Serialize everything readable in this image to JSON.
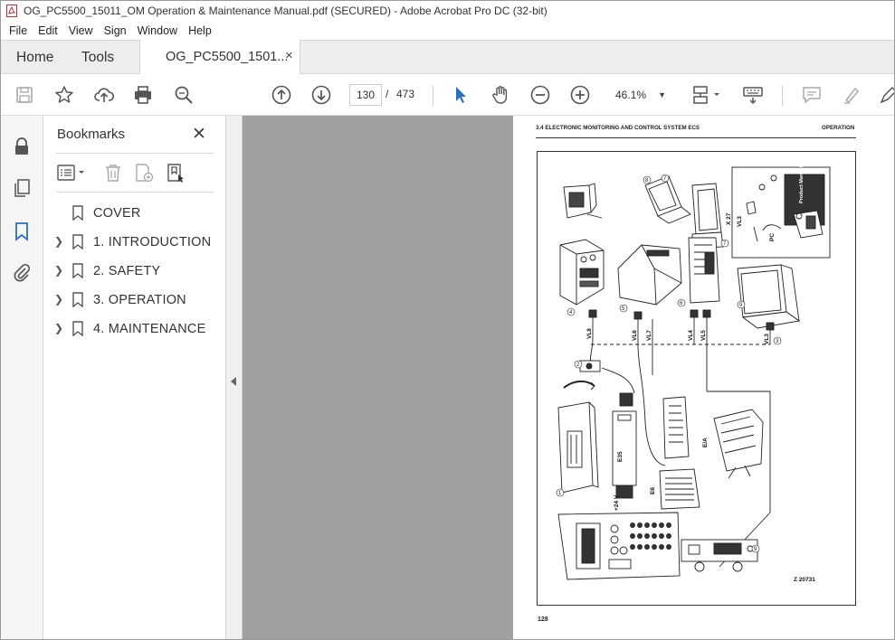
{
  "window": {
    "title": "OG_PC5500_15011_OM Operation & Maintenance Manual.pdf (SECURED) - Adobe Acrobat Pro DC (32-bit)"
  },
  "menu": [
    "File",
    "Edit",
    "View",
    "Sign",
    "Window",
    "Help"
  ],
  "tabs": {
    "home": "Home",
    "tools": "Tools",
    "document": "OG_PC5500_1501...",
    "close_glyph": "×"
  },
  "toolbar": {
    "current_page": "130",
    "separator": "/",
    "total_pages": "473",
    "zoom": "46.1%"
  },
  "bookmarks": {
    "title": "Bookmarks",
    "close_glyph": "✕",
    "items": [
      {
        "label": "COVER",
        "expandable": false
      },
      {
        "label": "1.  INTRODUCTION",
        "expandable": true
      },
      {
        "label": "2.  SAFETY",
        "expandable": true
      },
      {
        "label": "3.  OPERATION",
        "expandable": true
      },
      {
        "label": "4.  MAINTENANCE",
        "expandable": true
      }
    ]
  },
  "page": {
    "header_left": "3.4 ELECTRONIC MONITORING AND CONTROL SYSTEM ECS",
    "header_right": "OPERATION",
    "page_number": "128",
    "figure_labels": {
      "figure_id": "Z 20731",
      "product_manual": "Product Manual",
      "cable_vl3_top": "VL3",
      "cable_x27": "X 27",
      "cable_pc": "PC",
      "cable_vl8": "VL8",
      "cable_vl6": "VL6",
      "cable_vl7": "VL7",
      "cable_vl4": "VL4",
      "cable_vl5": "VL5",
      "cable_vl3": "VL3",
      "module_e35": "E35",
      "module_e6": "E6",
      "voltage": "+24 V",
      "io": "E/A"
    }
  },
  "colors": {
    "accent_blue": "#2b6fbf",
    "tab_bg": "#ededed",
    "doc_bg": "#a0a0a0"
  }
}
